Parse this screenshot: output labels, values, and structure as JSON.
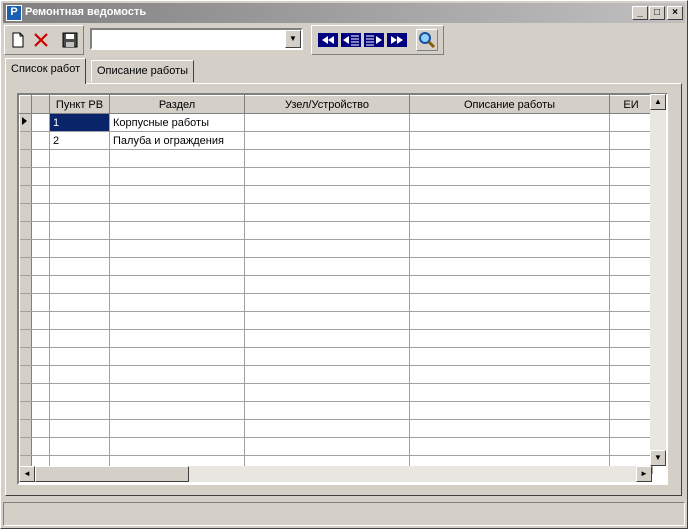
{
  "window": {
    "title": "Ремонтная ведомость",
    "minimize_icon": "minimize-icon",
    "maximize_icon": "maximize-icon",
    "close_icon": "close-icon"
  },
  "toolbar": {
    "new_icon": "new-document-icon",
    "delete_icon": "delete-icon",
    "save_icon": "save-icon",
    "combo_value": "",
    "first_icon": "first-record-icon",
    "prev_icon": "previous-record-icon",
    "next_icon": "next-record-icon",
    "last_icon": "last-record-icon",
    "search_icon": "search-icon"
  },
  "tabs": [
    {
      "label": "Список работ",
      "active": true
    },
    {
      "label": "Описание работы",
      "active": false
    }
  ],
  "grid": {
    "columns": [
      "Пункт РВ",
      "Раздел",
      "Узел/Устройство",
      "Описание работы",
      "ЕИ"
    ],
    "rows": [
      [
        "1",
        "Корпусные работы",
        "",
        "",
        ""
      ],
      [
        "2",
        "Палуба и ограждения",
        "",
        "",
        ""
      ]
    ],
    "selected_row": 0
  },
  "colors": {
    "face": "#d4d0c8",
    "selection": "#0a246a",
    "title_gradient_start": "#808080",
    "toolbar_nav_icon": "#000080",
    "delete_icon": "#d00000"
  }
}
